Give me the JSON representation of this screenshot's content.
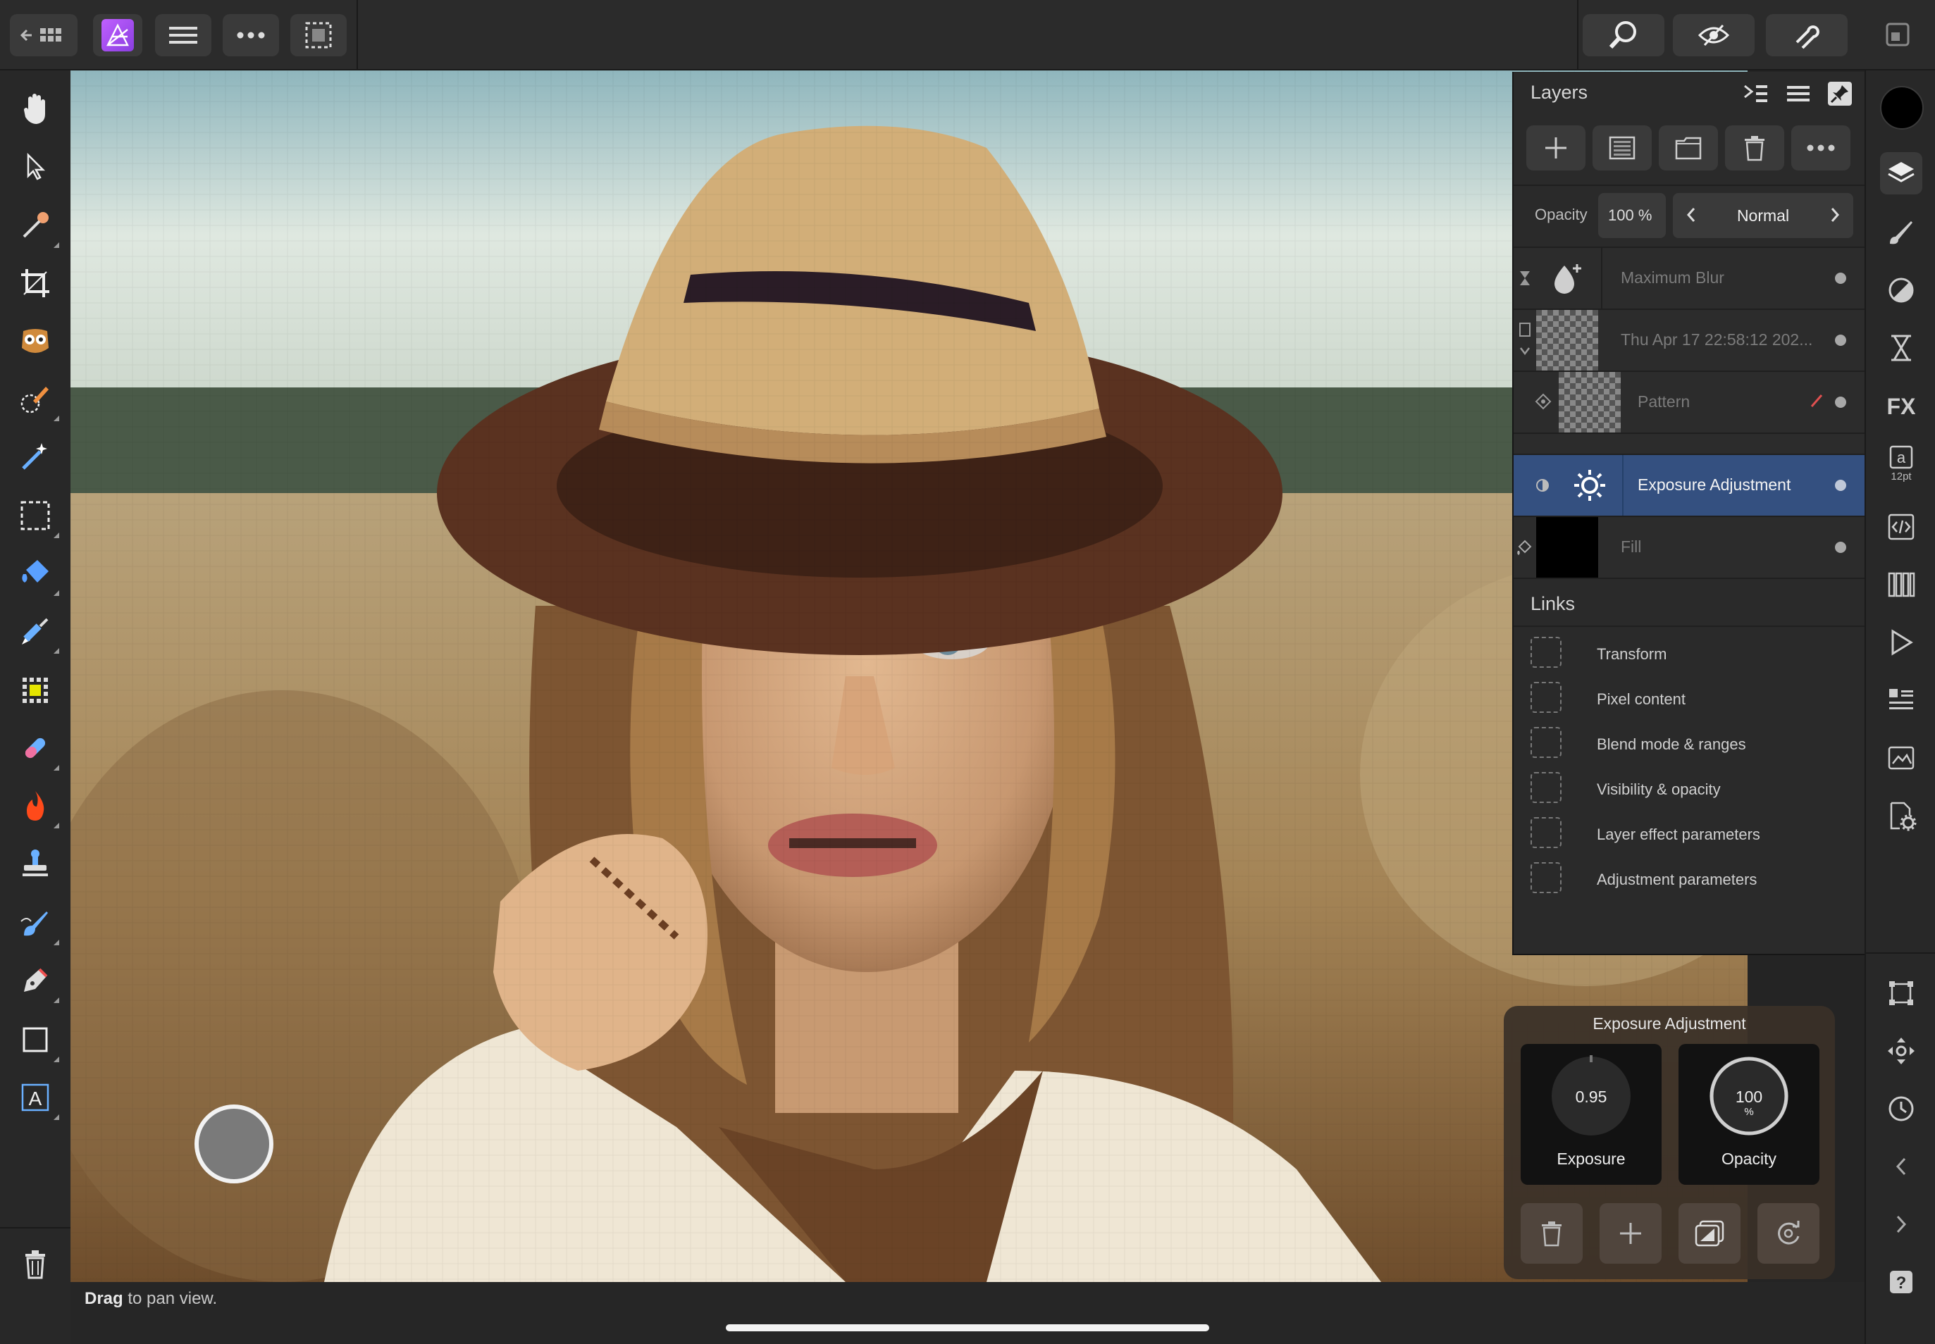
{
  "topbar": {
    "icons": [
      "back-grid-icon",
      "photo-persona-icon",
      "hamburger-menu-icon",
      "more-icon",
      "selection-icon",
      "zoom-icon",
      "view-quality-icon",
      "snapping-icon",
      "window-icon"
    ]
  },
  "tools": [
    "hand-tool",
    "move-tool",
    "color-picker-tool",
    "crop-tool",
    "red-eye-tool",
    "selection-brush-tool",
    "flood-select-tool",
    "marquee-tool",
    "flood-fill-tool",
    "paint-brush-tool",
    "pixel-tool",
    "healing-tool",
    "burn-tool",
    "clone-tool",
    "smudge-tool",
    "pen-tool",
    "rectangle-tool",
    "text-tool",
    "delete-tool"
  ],
  "layers_panel": {
    "title": "Layers",
    "opacity_label": "Opacity",
    "opacity_value": "100 %",
    "blend_mode": "Normal",
    "layers": [
      {
        "name": "Maximum Blur",
        "type": "live-filter"
      },
      {
        "name": "Thu Apr 17 22:58:12 202...",
        "type": "pixel"
      },
      {
        "name": "Pattern",
        "type": "pattern"
      },
      {
        "name": "Exposure Adjustment",
        "type": "adjustment",
        "selected": true
      },
      {
        "name": "Fill",
        "type": "fill"
      }
    ],
    "links_title": "Links",
    "links": [
      "Transform",
      "Pixel content",
      "Blend mode & ranges",
      "Visibility & opacity",
      "Layer effect parameters",
      "Adjustment parameters"
    ]
  },
  "hud": {
    "title": "Exposure Adjustment",
    "exposure_value": "0.95",
    "exposure_label": "Exposure",
    "opacity_value": "100",
    "opacity_unit": "%",
    "opacity_label": "Opacity"
  },
  "studio": {
    "text_size": "12pt"
  },
  "status": {
    "bold": "Drag",
    "rest": " to pan view."
  },
  "colors": {
    "accent_selected_row": "#345080",
    "primary_color": "#000000"
  }
}
